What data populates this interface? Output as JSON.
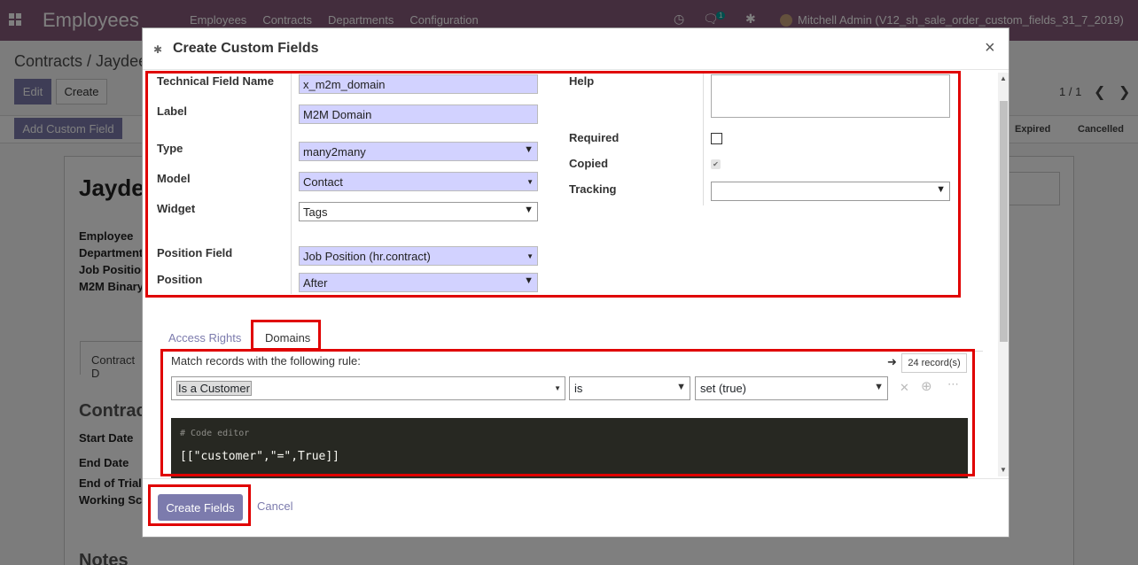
{
  "navbar": {
    "app_title": "Employees",
    "menu": [
      "Employees",
      "Contracts",
      "Departments",
      "Configuration"
    ],
    "messages_count": "1",
    "user_label": "Mitchell Admin (V12_sh_sale_order_custom_fields_31_7_2019)"
  },
  "page": {
    "breadcrumb_root": "Contracts",
    "breadcrumb_current": "Jaydee",
    "edit_label": "Edit",
    "create_label": "Create",
    "pager": "1 / 1",
    "add_custom_field_label": "Add Custom Field",
    "statuses": [
      "Expired",
      "Cancelled"
    ],
    "record_title": "Jaydee",
    "labels": [
      "Employee",
      "Department",
      "Job Position",
      "M2M Binary"
    ],
    "tab_label": "Contract D",
    "section_title": "Contrac",
    "lower_labels": [
      "Start Date",
      "End Date",
      "End of Trial",
      "Working Sc"
    ],
    "notes_title": "Notes"
  },
  "modal": {
    "title": "Create Custom Fields",
    "close": "×",
    "fields": {
      "technical_name_label": "Technical Field Name",
      "technical_name_value": "x_m2m_domain",
      "label_label": "Label",
      "label_value": "M2M Domain",
      "type_label": "Type",
      "type_value": "many2many",
      "model_label": "Model",
      "model_value": "Contact",
      "widget_label": "Widget",
      "widget_value": "Tags",
      "position_field_label": "Position Field",
      "position_field_value": "Job Position (hr.contract)",
      "position_label": "Position",
      "position_value": "After",
      "help_label": "Help",
      "required_label": "Required",
      "copied_label": "Copied",
      "tracking_label": "Tracking",
      "tracking_value": ""
    },
    "tabs": [
      "Access Rights",
      "Domains"
    ],
    "domain": {
      "intro": "Match records with the following rule:",
      "records": "24 record(s)",
      "field": "Is a Customer",
      "operator": "is",
      "value": "set (true)",
      "code_comment": "# Code editor",
      "code": "[[\"customer\",\"=\",True]]"
    },
    "footer": {
      "create_fields_label": "Create Fields",
      "cancel_label": "Cancel"
    }
  }
}
